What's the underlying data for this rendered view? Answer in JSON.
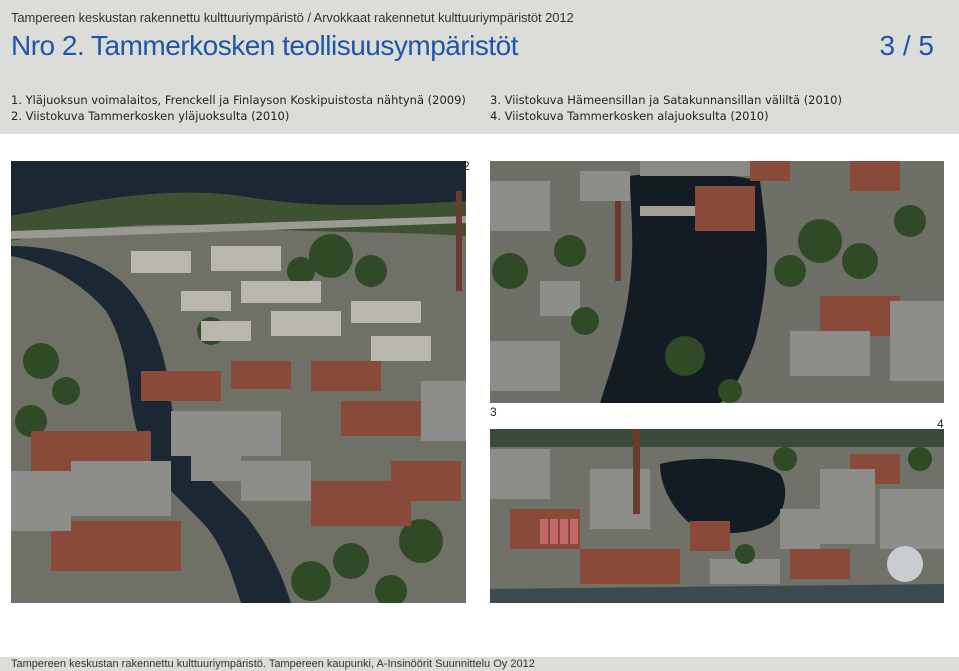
{
  "header": {
    "breadcrumb": "Tampereen keskustan rakennettu kulttuuriympäristö / Arvokkaat rakennetut kulttuuriympäristöt 2012",
    "title": "Nro 2. Tammerkosken teollisuusympäristöt",
    "page_number": "3 / 5"
  },
  "captions": {
    "left": [
      "1. Yläjuoksun voimalaitos, Frenckell ja Finlayson Koskipuistosta nähtynä (2009)",
      "2. Viistokuva Tammerkosken yläjuoksulta (2010)"
    ],
    "right": [
      "3. Viistokuva Hämeensillan ja Satakunnansillan väliltä (2010)",
      "4. Viistokuva Tammerkosken alajuoksulta (2010)"
    ]
  },
  "photos": [
    {
      "label": "2"
    },
    {
      "label": "3"
    },
    {
      "label": "4"
    }
  ],
  "footer": {
    "text": "Tampereen keskustan rakennettu kulttuuriympäristö. Tampereen kaupunki, A-Insinöörit Suunnittelu Oy 2012"
  },
  "colors": {
    "title_blue": "#1f56a8",
    "header_bg": "#dcdcd8",
    "water": "#1b2733",
    "roof_red": "#8a4a3a",
    "roof_grey": "#8d8d8a",
    "tree_green": "#2f4a25"
  }
}
